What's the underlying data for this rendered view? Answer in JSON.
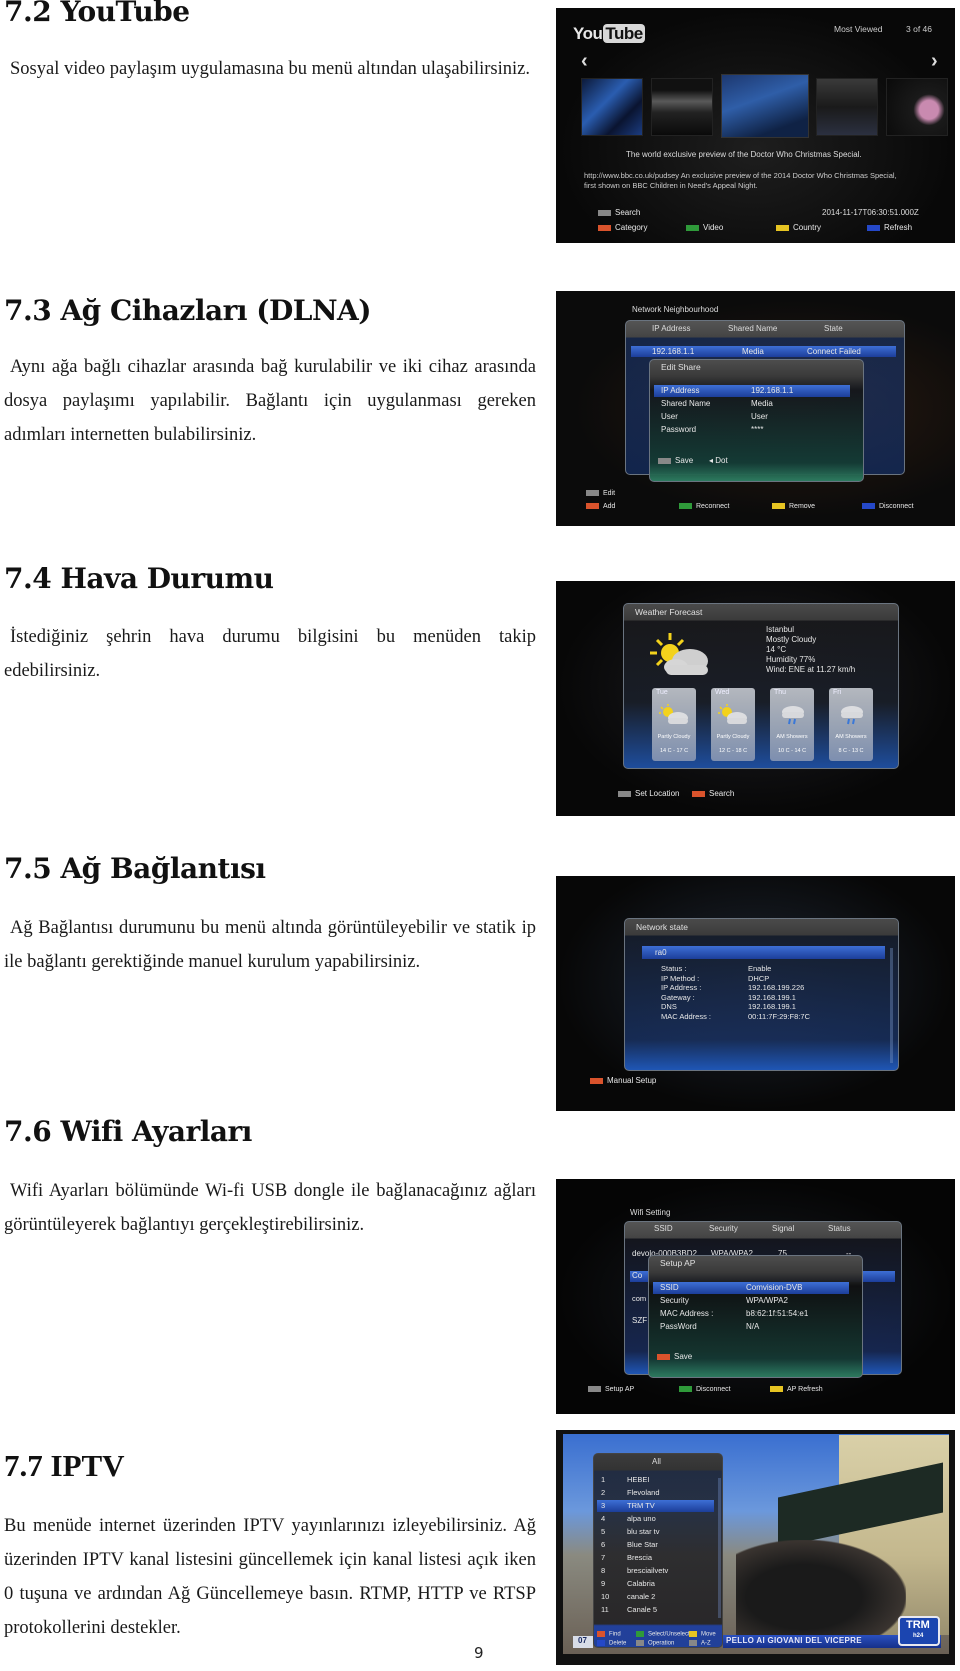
{
  "sections": [
    {
      "heading": "7.2 YouTube",
      "paragraph": "Sosyal video paylaşım uygulamasına bu menü altından ulaşabilirsiniz."
    },
    {
      "heading": "7.3 Ağ Cihazları (DLNA)",
      "paragraph": "Aynı ağa bağlı cihazlar arasında bağ kurulabilir ve iki cihaz arasında dosya paylaşımı yapılabilir. Bağlantı için uygulanması gereken adımları internetten bulabilirsiniz."
    },
    {
      "heading": "7.4 Hava Durumu",
      "paragraph": "İstediğiniz şehrin hava durumu bilgisini bu menüden takip edebilirsiniz."
    },
    {
      "heading": "7.5 Ağ Bağlantısı",
      "paragraph": "Ağ Bağlantısı durumunu bu menü altında görüntüleyebilir ve statik ip ile bağlantı gerektiğinde manuel kurulum yapabilirsiniz."
    },
    {
      "heading": "7.6 Wifi Ayarları",
      "paragraph": "Wifi Ayarları bölümünde Wi-fi USB dongle ile bağlanacağınız ağları görüntüleyerek bağlantıyı gerçekleştirebilirsiniz."
    },
    {
      "heading": "7.7 IPTV",
      "paragraph": "Bu menüde internet üzerinden IPTV yayınlarınızı izleyebilirsiniz. Ağ üzerinden IPTV kanal listesini güncellemek için kanal listesi açık iken 0 tuşuna ve ardından Ağ Güncellemeye basın. RTMP, HTTP ve RTSP protokollerini destekler."
    }
  ],
  "page_number": "9",
  "colors": {
    "red_key": "#d9532c",
    "green_key": "#2f9a3a",
    "yellow_key": "#e6c422",
    "blue_key": "#2548c8",
    "selection": "#2b56c0"
  },
  "youtube": {
    "logo_you": "You",
    "logo_tube": "Tube",
    "feed": "Most Viewed",
    "counter": "3 of 46",
    "prev_icon": "‹",
    "next_icon": "›",
    "title": "The world exclusive preview of the Doctor Who Christmas Special.",
    "description_line1": "http://www.bbc.co.uk/pudsey An exclusive preview of the 2014 Doctor Who Christmas Special,",
    "description_line2": "first shown on BBC Children in Need's Appeal Night.",
    "timestamp": "2014-11-17T06:30:51.000Z",
    "keys": {
      "search": "Search",
      "category": "Category",
      "video": "Video",
      "country": "Country",
      "refresh": "Refresh"
    }
  },
  "dlna": {
    "title": "Network Neighbourhood",
    "columns": [
      "IP Address",
      "Shared Name",
      "State"
    ],
    "row": {
      "ip": "192.168.1.1",
      "name": "Media",
      "state": "Connect Failed"
    },
    "dialog": {
      "title": "Edit Share",
      "fields": [
        {
          "label": "IP Address",
          "value": "192.168.1.1"
        },
        {
          "label": "Shared Name",
          "value": "Media"
        },
        {
          "label": "User",
          "value": "User"
        },
        {
          "label": "Password",
          "value": "****"
        }
      ],
      "save": "Save",
      "dot": "Dot"
    },
    "keys": {
      "edit": "Edit",
      "add": "Add",
      "reconnect": "Reconnect",
      "remove": "Remove",
      "disconnect": "Disconnect"
    }
  },
  "weather": {
    "title": "Weather Forecast",
    "city": "Istanbul",
    "condition": "Mostly Cloudy",
    "temperature": "14 °C",
    "humidity": "Humidity 77%",
    "wind": "Wind: ENE at 11.27 km/h",
    "forecast": [
      {
        "day": "Tue",
        "condition": "Partly Cloudy",
        "range": "14 C - 17 C",
        "icon": "partly-cloudy"
      },
      {
        "day": "Wed",
        "condition": "Partly Cloudy",
        "range": "12 C - 18 C",
        "icon": "partly-cloudy"
      },
      {
        "day": "Thu",
        "condition": "AM Showers",
        "range": "10 C - 14 C",
        "icon": "showers"
      },
      {
        "day": "Fri",
        "condition": "AM Showers",
        "range": "8 C - 13 C",
        "icon": "showers"
      }
    ],
    "keys": {
      "set_location": "Set Location",
      "search": "Search"
    }
  },
  "network_state": {
    "title": "Network state",
    "interface": "ra0",
    "fields": [
      {
        "label": "Status :",
        "value": "Enable"
      },
      {
        "label": "IP Method :",
        "value": "DHCP"
      },
      {
        "label": "IP Address :",
        "value": "192.168.199.226"
      },
      {
        "label": "Gateway :",
        "value": "192.168.199.1"
      },
      {
        "label": "DNS",
        "value": "192.168.199.1"
      },
      {
        "label": "MAC Address :",
        "value": "00:11:7F:29:F8:7C"
      }
    ],
    "keys": {
      "manual_setup": "Manual Setup"
    }
  },
  "wifi": {
    "title": "Wifi Setting",
    "columns": [
      "SSID",
      "Security",
      "Signal",
      "Status"
    ],
    "first_row": {
      "ssid": "devolo-000B3BD2",
      "security": "WPA/WPA2",
      "signal": "75",
      "status": "--"
    },
    "partial_rows": [
      "Co",
      "com",
      "SZF"
    ],
    "dialog": {
      "title": "Setup AP",
      "fields": [
        {
          "label": "SSID",
          "value": "Comvision-DVB"
        },
        {
          "label": "Security",
          "value": "WPA/WPA2"
        },
        {
          "label": "MAC Address :",
          "value": "b8:62:1f:51:54:e1"
        },
        {
          "label": "PassWord",
          "value": "N/A"
        }
      ],
      "save": "Save"
    },
    "keys": {
      "setup_ap": "Setup AP",
      "disconnect": "Disconnect",
      "ap_refresh": "AP Refresh"
    }
  },
  "iptv": {
    "group": "All",
    "channels": [
      {
        "num": "1",
        "name": "HEBEI"
      },
      {
        "num": "2",
        "name": "Flevoland"
      },
      {
        "num": "3",
        "name": "TRM TV"
      },
      {
        "num": "4",
        "name": "alpa uno"
      },
      {
        "num": "5",
        "name": "blu star tv"
      },
      {
        "num": "6",
        "name": "Blue Star"
      },
      {
        "num": "7",
        "name": "Brescia"
      },
      {
        "num": "8",
        "name": "bresciailvetv"
      },
      {
        "num": "9",
        "name": "Calabria"
      },
      {
        "num": "10",
        "name": "canale 2"
      },
      {
        "num": "11",
        "name": "Canale 5"
      }
    ],
    "selected_index": 2,
    "keys": {
      "find": "Find",
      "select": "Select/Unselect",
      "move": "Move",
      "delete": "Delete",
      "operation": "Operation",
      "az": "A-Z"
    },
    "ticker": "PELLO AI GIOVANI DEL VICEPRE",
    "ticker_time": "07",
    "logo_top": "TRM",
    "logo_bottom": "h24"
  }
}
